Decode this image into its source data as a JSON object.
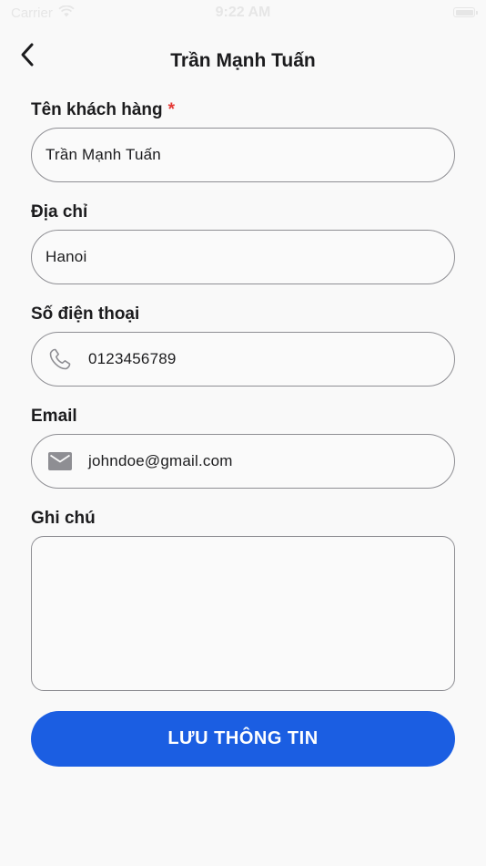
{
  "status_bar": {
    "carrier": "Carrier",
    "time": "9:22 AM",
    "wifi_icon": "wifi-icon",
    "battery_icon": "battery-icon"
  },
  "nav": {
    "title": "Trần Mạnh Tuấn",
    "back_icon": "chevron-left-icon"
  },
  "form": {
    "customer_name": {
      "label": "Tên khách hàng",
      "required_mark": "*",
      "value": "Trần Mạnh Tuấn"
    },
    "address": {
      "label": "Địa chỉ",
      "value": "Hanoi"
    },
    "phone": {
      "label": "Số điện thoại",
      "icon": "phone-icon",
      "value": "0123456789"
    },
    "email": {
      "label": "Email",
      "icon": "mail-icon",
      "value": "johndoe@gmail.com"
    },
    "note": {
      "label": "Ghi chú",
      "value": ""
    }
  },
  "save_button": {
    "label": "LƯU THÔNG TIN"
  },
  "colors": {
    "primary": "#1b5ee2",
    "required": "#e53935",
    "border": "#8e8e93",
    "background": "#f9f9f9"
  }
}
